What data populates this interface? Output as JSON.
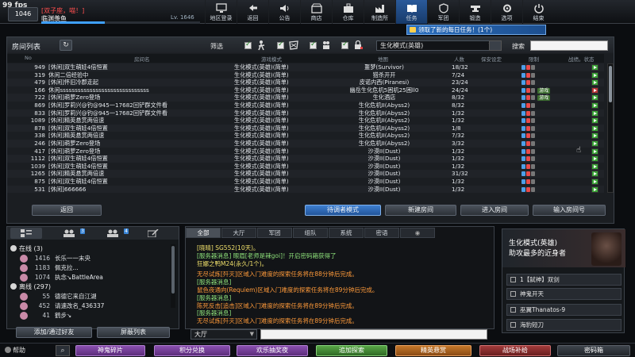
{
  "fps": "99 fps",
  "player": {
    "level_badge": "1046",
    "clan": "[双子座，喵！]",
    "name": "临渊羡鱼",
    "level_text": "Lv. 1646",
    "exp_percent": 40
  },
  "nav": [
    {
      "label": "地区登录",
      "icon": "monitor-icon"
    },
    {
      "label": "返回",
      "icon": "back-arrow-icon"
    },
    {
      "label": "公告",
      "icon": "speaker-icon"
    },
    {
      "label": "商店",
      "icon": "shop-icon"
    },
    {
      "label": "仓库",
      "icon": "briefcase-icon"
    },
    {
      "label": "制造所",
      "icon": "factory-icon"
    },
    {
      "label": "任务",
      "icon": "book-icon",
      "active": true
    },
    {
      "label": "军团",
      "icon": "shield-icon"
    },
    {
      "label": "锻造",
      "icon": "anvil-icon"
    },
    {
      "label": "选项",
      "icon": "gear-icon"
    },
    {
      "label": "结束",
      "icon": "power-icon"
    }
  ],
  "toast": "领取了新的每日任务！(1个)",
  "room_panel": {
    "title": "房间列表",
    "filter_label": "筛选",
    "mode_select": "生化模式(英雄)",
    "search_label": "搜索",
    "search_value": "",
    "columns": {
      "no": "No",
      "name": "房间名",
      "mode": "游戏模式",
      "map": "地图",
      "count": "人数",
      "password": "保安设定",
      "status": "限制",
      "state": "战绩。状态"
    },
    "rows": [
      {
        "no": "949",
        "name": "[休闲]双生萌娃4倍恒置",
        "mode": "生化模式(英雄)(简单)",
        "map": "噩梦(Survivor)",
        "count": "18/32",
        "tag": "",
        "play": "green"
      },
      {
        "no": "319",
        "name": "休闲二倍经验中",
        "mode": "生化模式(英雄)(简单)",
        "map": "猎杀开开",
        "count": "7/24",
        "tag": "",
        "play": "green"
      },
      {
        "no": "479",
        "name": "[休闲]怀旧冷郡走起",
        "mode": "生化模式(英雄)(简单)",
        "map": "皮诺内西(Piranesi)",
        "count": "23/24",
        "tag": "",
        "play": "green"
      },
      {
        "no": "166",
        "name": "休闲ssssssssssssssssssssssssssssss",
        "mode": "生化模式(英雄)(简单)",
        "map": "幽岳生化危机5困机25困ll0",
        "count": "24/24",
        "tag": "游戏",
        "play": "red"
      },
      {
        "no": "722",
        "name": "[休闲]萌萝Zero登场",
        "mode": "生化模式(英雄)(简单)",
        "map": "生化酒店",
        "count": "8/32",
        "tag": "游戏",
        "play": "green"
      },
      {
        "no": "869",
        "name": "[休闲]罗莉兴@钓@945一17682回铲群文件看",
        "mode": "生化模式(英雄)(简单)",
        "map": "生化危机II(Abyss2)",
        "count": "8/32",
        "tag": "",
        "play": "green"
      },
      {
        "no": "833",
        "name": "[休闲]罗莉兴@钓@945一17682回铲群文件看",
        "mode": "生化模式(英雄)(简单)",
        "map": "生化危机II(Abyss2)",
        "count": "1/32",
        "tag": "",
        "play": "green"
      },
      {
        "no": "1089",
        "name": "[休闲]精英悬赏两倍速",
        "mode": "生化模式(英雄)(简单)",
        "map": "生化危机II(Abyss2)",
        "count": "1/32",
        "tag": "",
        "play": "green"
      },
      {
        "no": "878",
        "name": "[休闲]双生萌娃4倍恒置",
        "mode": "生化模式(英雄)(简单)",
        "map": "生化危机II(Abyss2)",
        "count": "1/8",
        "tag": "",
        "play": "green"
      },
      {
        "no": "338",
        "name": "[休闲]精英悬赏两倍速",
        "mode": "生化模式(英雄)(简单)",
        "map": "生化危机II(Abyss2)",
        "count": "7/32",
        "tag": "",
        "play": "green"
      },
      {
        "no": "246",
        "name": "[休闲]萌萝Zero登场",
        "mode": "生化模式(英雄)(简单)",
        "map": "生化危机II(Abyss2)",
        "count": "3/32",
        "tag": "",
        "play": "green"
      },
      {
        "no": "417",
        "name": "[休闲]萌萝Zero登场",
        "mode": "生化模式(英雄)(简单)",
        "map": "沙漠II(Dust)",
        "count": "1/32",
        "tag": "",
        "play": "green"
      },
      {
        "no": "1112",
        "name": "[休闲]双生萌娃4倍恒置",
        "mode": "生化模式(英雄)(简单)",
        "map": "沙漠II(Dust)",
        "count": "1/32",
        "tag": "",
        "play": "green"
      },
      {
        "no": "1039",
        "name": "[休闲]双生萌娃4倍恒置",
        "mode": "生化模式(英雄)(简单)",
        "map": "沙漠II(Dust)",
        "count": "1/32",
        "tag": "",
        "play": "green"
      },
      {
        "no": "1265",
        "name": "[休闲]精英悬赏两倍速",
        "mode": "生化模式(英雄)(简单)",
        "map": "沙漠II(Dust)",
        "count": "31/32",
        "tag": "",
        "play": "green"
      },
      {
        "no": "875",
        "name": "[休闲]双生萌娃4倍恒置",
        "mode": "生化模式(英雄)(简单)",
        "map": "沙漠II(Dust)",
        "count": "1/32",
        "tag": "",
        "play": "green"
      },
      {
        "no": "531",
        "name": "[休闲]666666",
        "mode": "生化模式(英雄)(简单)",
        "map": "沙漠II(Dust)",
        "count": "1/32",
        "tag": "",
        "play": "green"
      }
    ],
    "buttons": {
      "back": "返回",
      "waiting_mode": "待调者模式",
      "new_room": "新建房间",
      "enter_room": "进入房间",
      "enter_room_no": "输入房间号"
    }
  },
  "friends": {
    "tab_badges": [
      "",
      "3",
      "4",
      ""
    ],
    "groups": [
      {
        "label": "在线 (3)",
        "items": [
          {
            "lv": "1416",
            "name": "长乐一一末央"
          },
          {
            "lv": "1183",
            "name": "佩克拉..."
          },
          {
            "lv": "1074",
            "name": "执念↘BattleArea"
          }
        ]
      },
      {
        "label": "离线 (297)",
        "items": [
          {
            "lv": "55",
            "name": "德德它来自江湖"
          },
          {
            "lv": "452",
            "name": "请速改名_436337"
          },
          {
            "lv": "41",
            "name": "鹤步↘"
          }
        ]
      }
    ],
    "buttons": {
      "add": "添加/通过好友",
      "block": "屏蔽列表"
    }
  },
  "chat": {
    "tabs": [
      "全部",
      "大厅",
      "军团",
      "组队",
      "系统",
      "密语",
      ""
    ],
    "messages": [
      {
        "text": "[晓晴] SG552(10天)。",
        "color": "yellow"
      },
      {
        "text": "[服务器消息] 眼眉[老师是辣goi]！开启密码箱获得了",
        "color": "green"
      },
      {
        "text": "狂娜之鸭M24(永久/1个)。",
        "color": "yellow"
      },
      {
        "text": "",
        "color": "white"
      },
      {
        "text": "无尽试炼[歼灭]区域入门难度的探索任务将在88分钟后完成。",
        "color": "orange"
      },
      {
        "text": "[服务器消息]",
        "color": "green"
      },
      {
        "text": "鼠色夜通向(Requiem)区域入门难度的探索任务将在89分钟后完成。",
        "color": "orange"
      },
      {
        "text": "[服务器消息]",
        "color": "green"
      },
      {
        "text": "陈死反击[追击]区域入门难度的探索任务将在89分钟后完成。",
        "color": "orange"
      },
      {
        "text": "[服务器消息]",
        "color": "green"
      },
      {
        "text": "无尽试炼[歼灭]区域入门难度的探索任务将在89分钟后完成。",
        "color": "orange"
      }
    ],
    "channel": "大厅"
  },
  "mission": {
    "title": "生化模式(英雄)",
    "desc": "助攻最多的近身者",
    "items": [
      "1【弑神】双剑",
      "神鬼开天",
      "巫翼Thanatos-9",
      "海豹短刀"
    ]
  },
  "bottom_bar": {
    "help": "帮助",
    "buttons": [
      "神鬼碎片",
      "积分兑换",
      "欢乐抽奖夜",
      "追加探索",
      "精英悬赏",
      "战场补给",
      "密码箱"
    ]
  }
}
